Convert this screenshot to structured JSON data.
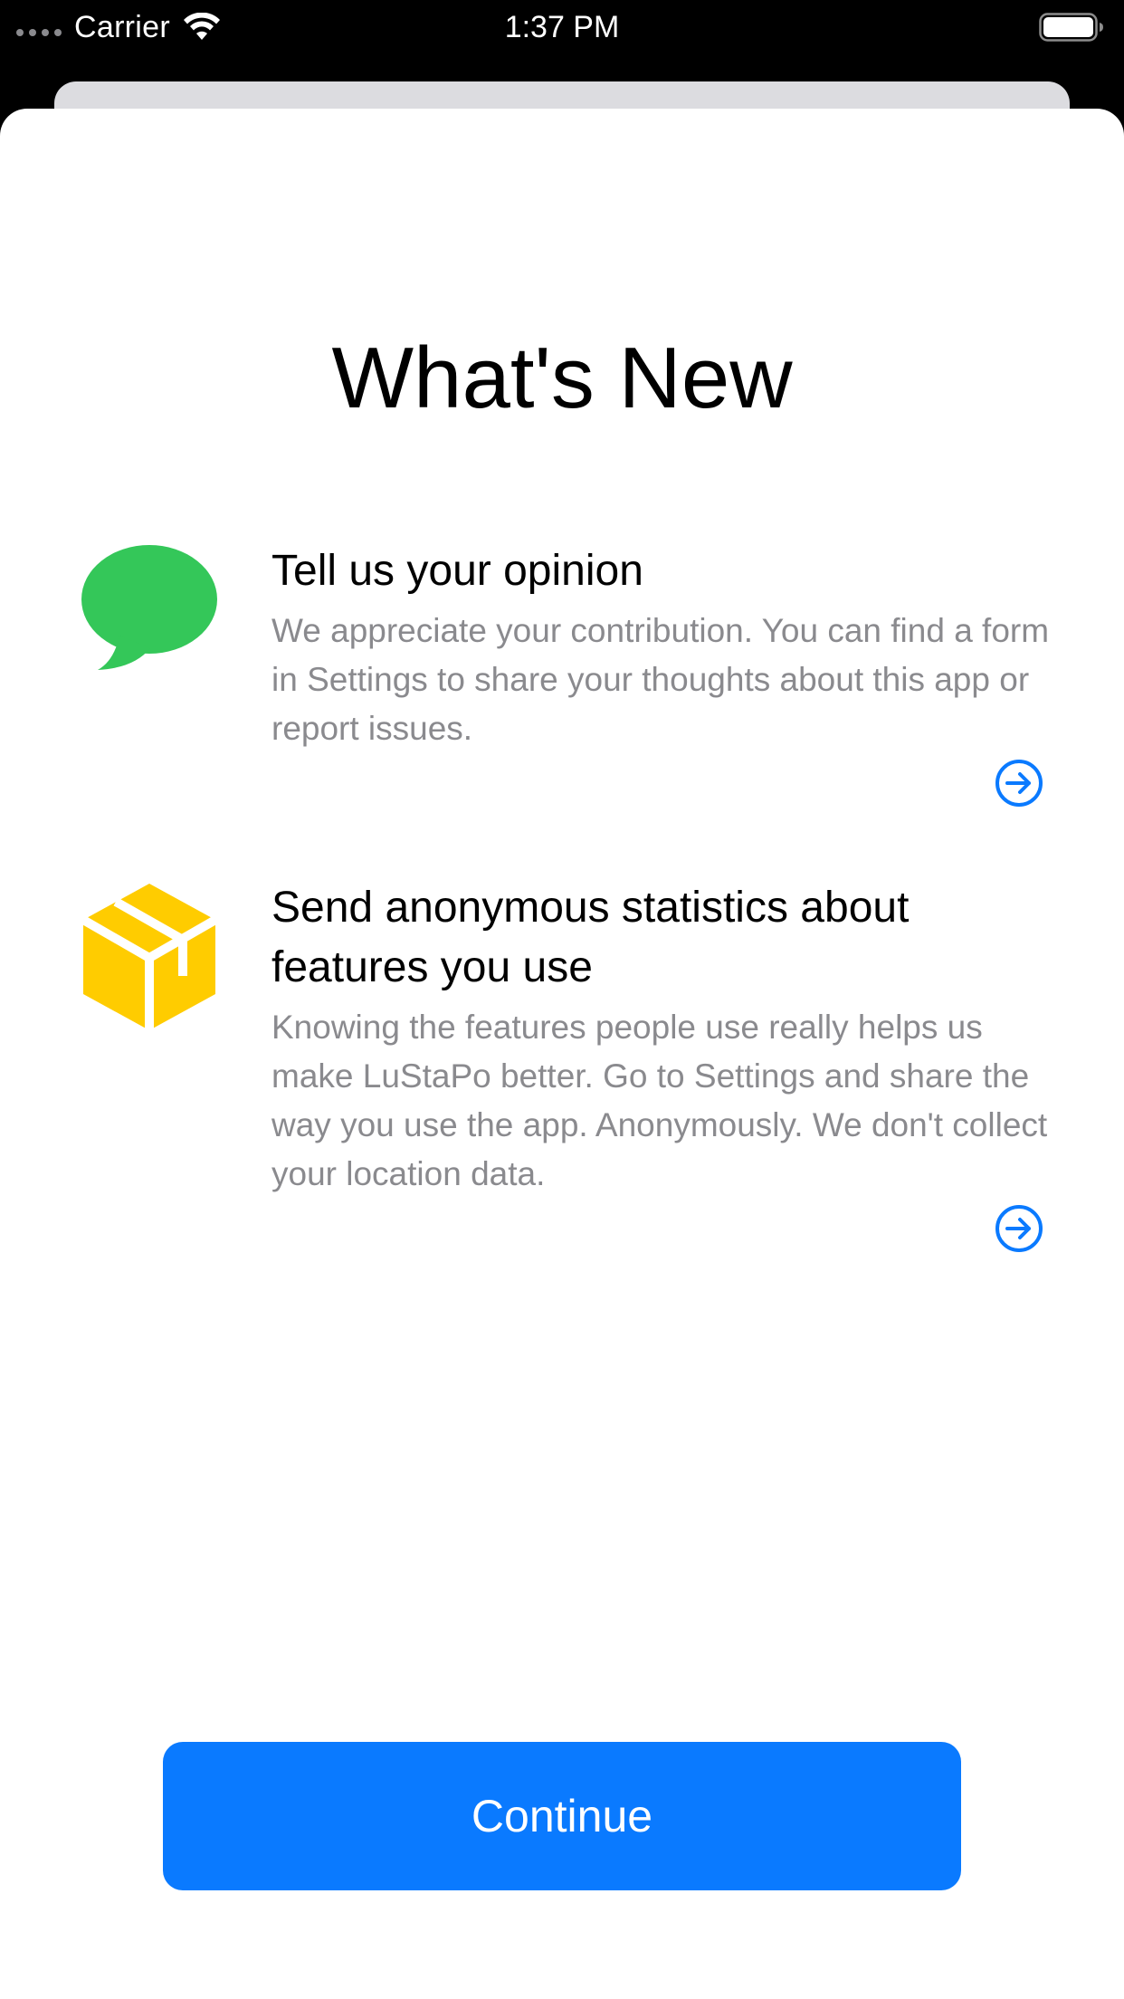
{
  "status_bar": {
    "carrier": "Carrier",
    "time": "1:37 PM",
    "icons": [
      "signal-dots-icon",
      "wifi-icon",
      "battery-icon"
    ]
  },
  "screen": {
    "title": "What's New"
  },
  "features": [
    {
      "icon": "speech-bubble-icon",
      "icon_color": "#34c759",
      "title": "Tell us your opinion",
      "description": "We appreciate your contribution. You can find a form in Settings to share your thoughts about this app or report issues.",
      "action_icon": "arrow-right-circle-icon"
    },
    {
      "icon": "package-box-icon",
      "icon_color": "#ffcc00",
      "title": "Send anonymous statistics about features you use",
      "description": "Knowing the features people use really helps us make LuStaPo better. Go to Settings and share the way you use the app. Anonymously. We don't collect your location data.",
      "action_icon": "arrow-right-circle-icon"
    }
  ],
  "continue_button": {
    "label": "Continue"
  },
  "colors": {
    "accent": "#0a7aff",
    "description_text": "#8a8a8e",
    "sheet_background": "#ffffff",
    "status_bar_background": "#000000"
  }
}
